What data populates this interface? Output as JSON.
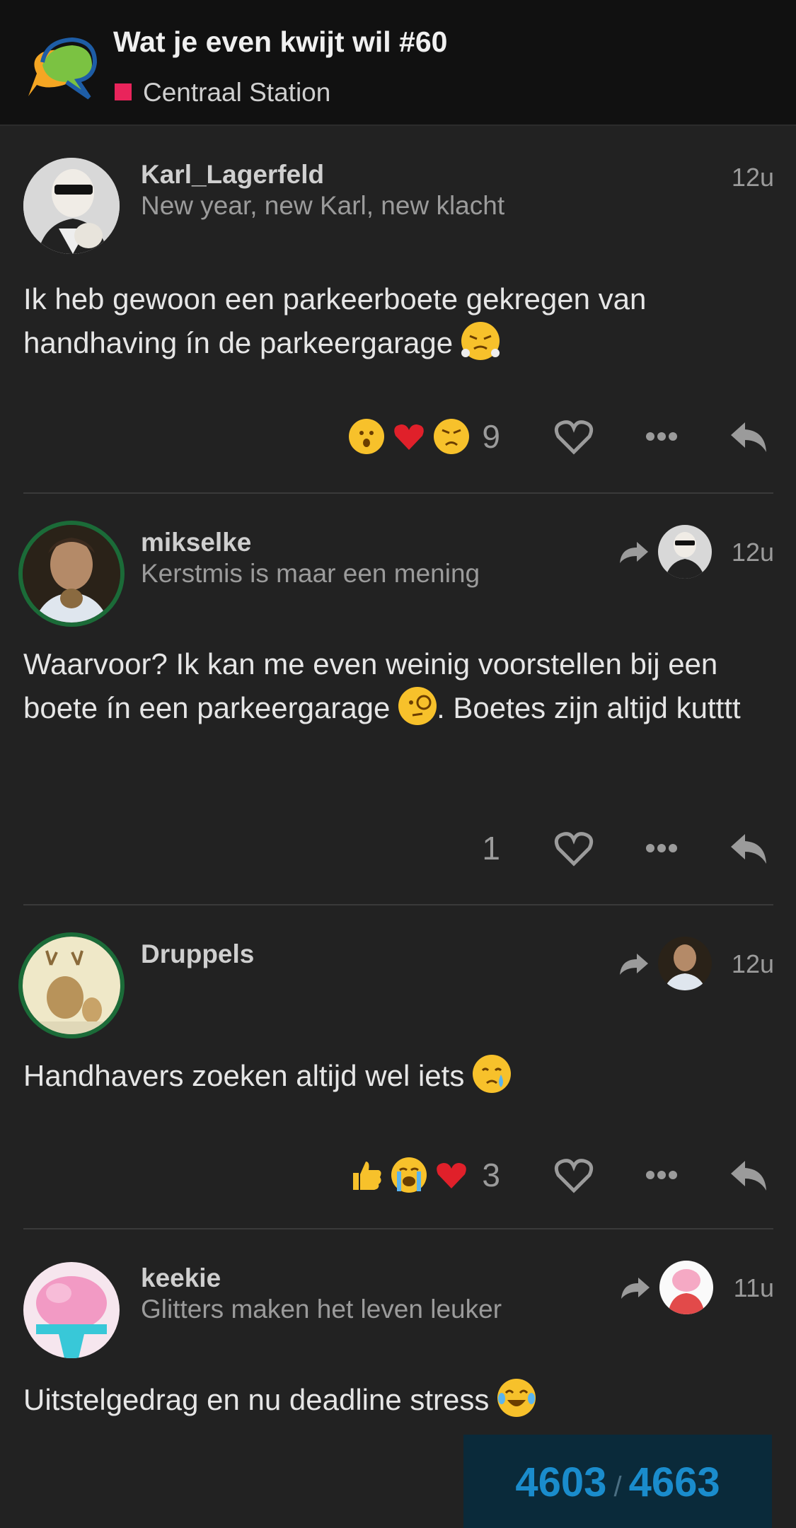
{
  "header": {
    "topic_title": "Wat je even kwijt wil #60",
    "category": "Centraal Station",
    "category_color": "#e9245b"
  },
  "posts": [
    {
      "username": "Karl_Lagerfeld",
      "user_title": "New year, new Karl, new klacht",
      "time": "12u",
      "text": "Ik heb gewoon een parkeerboete gekregen van handhaving ín de parkeergarage",
      "text_emoji": "face-with-steam-from-nose",
      "reactions": [
        "hushed-face",
        "red-heart",
        "angry-face"
      ],
      "count": "9"
    },
    {
      "username": "mikselke",
      "user_title": "Kerstmis is maar een mening",
      "time": "12u",
      "text": "Waarvoor? Ik kan me even weinig voorstellen bij een boete ín een parkeergarage",
      "text_emoji": "face-with-monocle",
      "text_after": ". Boetes zijn altijd kutttt",
      "count": "1"
    },
    {
      "username": "Druppels",
      "time": "12u",
      "text": "Handhavers zoeken altijd wel iets",
      "text_emoji": "face-holding-back-tears",
      "reactions": [
        "thumbs-up",
        "loudly-crying-face",
        "red-heart"
      ],
      "count": "3"
    },
    {
      "username": "keekie",
      "user_title": "Glitters maken het leven leuker",
      "time": "11u",
      "text": "Uitstelgedrag en nu deadline stress",
      "text_emoji": "face-with-tears-of-joy"
    }
  ],
  "progress": {
    "current": "4603",
    "separator": "/",
    "total": "4663"
  }
}
